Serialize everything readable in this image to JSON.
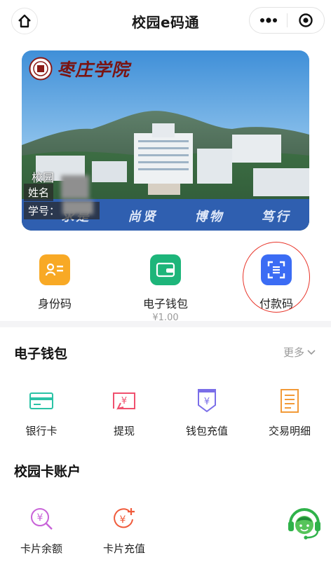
{
  "header": {
    "title": "校园e码通",
    "home_icon": "home-icon",
    "more_icon": "more-dots-icon",
    "close_icon": "target-close-icon"
  },
  "card": {
    "school_name": "枣庄学院",
    "name_label": "姓名",
    "id_label": "学号：",
    "motto": [
      "求是",
      "尚贤",
      "博物",
      "笃行"
    ],
    "partial_text": "校园"
  },
  "quick_actions": [
    {
      "label": "身份码",
      "sub": "",
      "icon": "id-card-icon",
      "color": "#f6a623"
    },
    {
      "label": "电子钱包",
      "sub": "¥1.00",
      "icon": "wallet-icon",
      "color": "#1fb97a"
    },
    {
      "label": "付款码",
      "sub": "",
      "icon": "scan-pay-icon",
      "color": "#3a6df5"
    }
  ],
  "ewallet": {
    "title": "电子钱包",
    "more": "更多",
    "items": [
      {
        "label": "银行卡",
        "icon": "bank-card-icon",
        "color": "#2bc3a6"
      },
      {
        "label": "提现",
        "icon": "withdraw-icon",
        "color": "#f0506e"
      },
      {
        "label": "钱包充值",
        "icon": "wallet-recharge-icon",
        "color": "#7a6ee8"
      },
      {
        "label": "交易明细",
        "icon": "transaction-list-icon",
        "color": "#f29a38"
      }
    ]
  },
  "campus_account": {
    "title": "校园卡账户",
    "items": [
      {
        "label": "卡片余额",
        "icon": "card-balance-icon",
        "color": "#c862d8"
      },
      {
        "label": "卡片充值",
        "icon": "card-recharge-icon",
        "color": "#f05a3a"
      }
    ],
    "support_icon": "customer-service-icon"
  }
}
